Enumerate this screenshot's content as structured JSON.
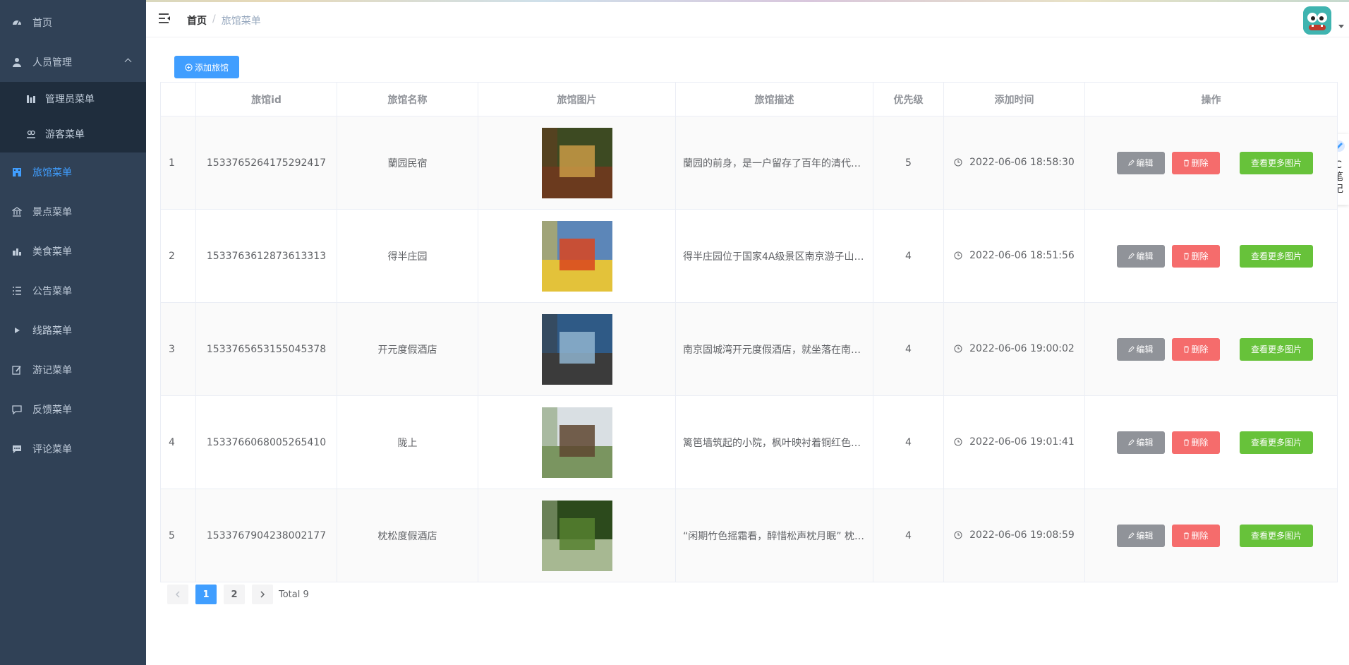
{
  "sidebar": {
    "items": [
      {
        "label": "首页",
        "icon": "dashboard-icon"
      },
      {
        "label": "人员管理",
        "icon": "user-icon"
      },
      {
        "label": "管理员菜单",
        "icon": "chart-icon"
      },
      {
        "label": "游客菜单",
        "icon": "people-icon"
      },
      {
        "label": "旅馆菜单",
        "icon": "hotel-icon"
      },
      {
        "label": "景点菜单",
        "icon": "bank-icon"
      },
      {
        "label": "美食菜单",
        "icon": "food-icon"
      },
      {
        "label": "公告菜单",
        "icon": "list-icon"
      },
      {
        "label": "线路菜单",
        "icon": "route-icon"
      },
      {
        "label": "游记菜单",
        "icon": "edit-icon"
      },
      {
        "label": "反馈菜单",
        "icon": "message-icon"
      },
      {
        "label": "评论菜单",
        "icon": "comment-icon"
      }
    ],
    "active_color": "#409eff"
  },
  "header": {
    "breadcrumb": {
      "home": "首页",
      "separator": "/",
      "current": "旅馆菜单"
    }
  },
  "side_note": {
    "text": "C 笔 记"
  },
  "toolbar": {
    "add_label": "添加旅馆"
  },
  "table": {
    "headers": [
      "",
      "旅馆id",
      "旅馆名称",
      "旅馆图片",
      "旅馆描述",
      "优先级",
      "添加时间",
      "操作"
    ],
    "rows": [
      {
        "index": "1",
        "id": "1533765264175292417",
        "name": "蘭园民宿",
        "desc": "蘭园的前身，是一户留存了百年的清代…",
        "priority": "5",
        "time": "2022-06-06 18:58:30"
      },
      {
        "index": "2",
        "id": "1533763612873613313",
        "name": "得半庄园",
        "desc": "得半庄园位于国家4A级景区南京游子山…",
        "priority": "4",
        "time": "2022-06-06 18:51:56"
      },
      {
        "index": "3",
        "id": "1533765653155045378",
        "name": "开元度假酒店",
        "desc": "南京固城湾开元度假酒店，就坐落在南…",
        "priority": "4",
        "time": "2022-06-06 19:00:02"
      },
      {
        "index": "4",
        "id": "1533766068005265410",
        "name": "陇上",
        "desc": "篱笆墙筑起的小院，枫叶映衬着铜红色…",
        "priority": "4",
        "time": "2022-06-06 19:01:41"
      },
      {
        "index": "5",
        "id": "1533767904238002177",
        "name": "枕松度假酒店",
        "desc": "“闲期竹色摇霜看，醉惜松声枕月眠” 枕…",
        "priority": "4",
        "time": "2022-06-06 19:08:59"
      }
    ],
    "actions": {
      "edit": "编辑",
      "delete": "删除",
      "more": "查看更多图片"
    }
  },
  "pagination": {
    "pages": [
      "1",
      "2"
    ],
    "current": "1",
    "total": "Total 9"
  },
  "colors": {
    "primary": "#409eff",
    "danger": "#f56c6c",
    "success": "#67c23a",
    "info": "#909399",
    "sidebar_bg": "#304156"
  }
}
